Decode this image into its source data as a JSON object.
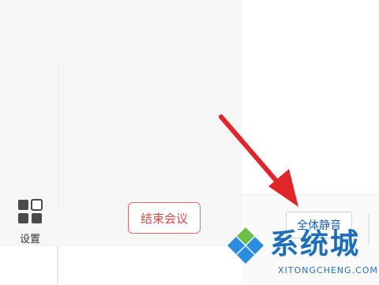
{
  "toolbar": {
    "settings_label": "设置",
    "end_meeting_label": "结束会议",
    "mute_all_label": "全体静音"
  },
  "watermark": {
    "title": "系统城",
    "subtitle": "XITONGCHENG.COM"
  },
  "colors": {
    "end_meeting_accent": "#e36a6a",
    "mute_all_text": "#1a5fb4",
    "arrow": "#e0252b",
    "watermark_blue": "#1f6fb8",
    "watermark_green": "#6cc04a"
  },
  "icons": {
    "settings": "grid-squares-icon",
    "annotation": "red-arrow-icon",
    "watermark": "diamond-logo-icon"
  }
}
